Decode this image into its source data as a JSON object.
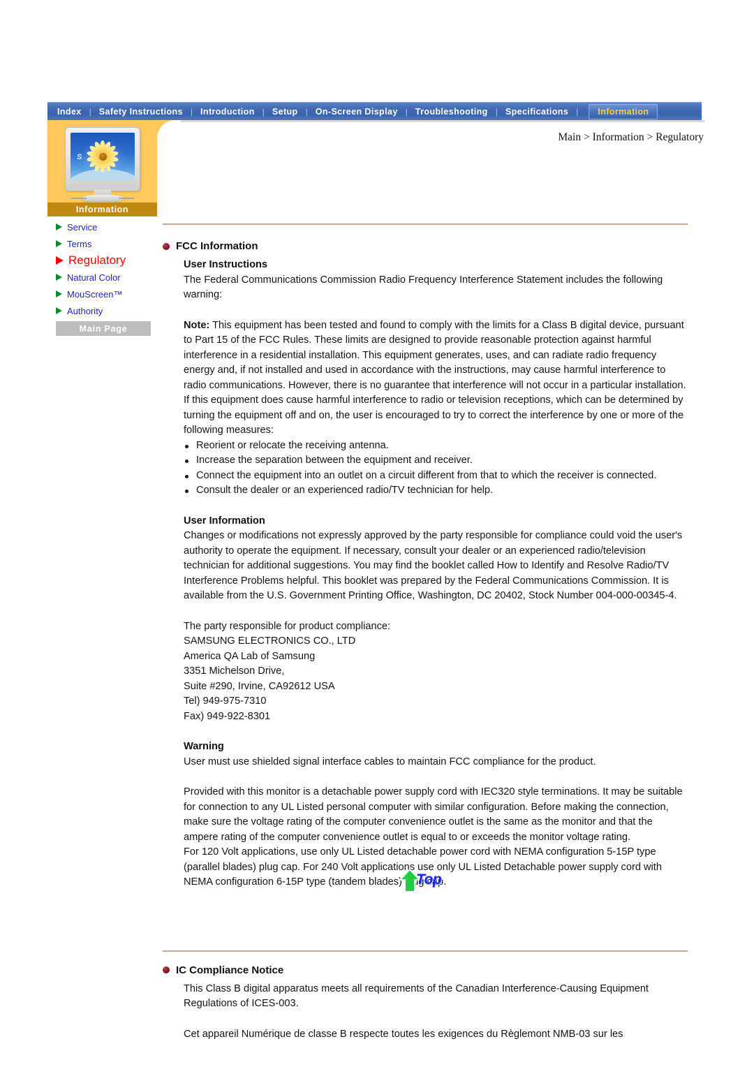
{
  "topnav": {
    "items": [
      {
        "label": "Index",
        "active": false
      },
      {
        "label": "Safety Instructions",
        "active": false
      },
      {
        "label": "Introduction",
        "active": false
      },
      {
        "label": "Setup",
        "active": false
      },
      {
        "label": "On-Screen Display",
        "active": false
      },
      {
        "label": "Troubleshooting",
        "active": false
      },
      {
        "label": "Specifications",
        "active": false
      },
      {
        "label": "Information",
        "active": true
      }
    ],
    "separator": "|"
  },
  "breadcrumb": "Main > Information > Regulatory",
  "sidebar": {
    "thumbnail_band_label": "Information",
    "monitor_logo_letter": "S",
    "items": [
      {
        "label": "Service",
        "current": false
      },
      {
        "label": "Terms",
        "current": false
      },
      {
        "label": "Regulatory",
        "current": true
      },
      {
        "label": "Natural Color",
        "current": false
      },
      {
        "label": "MouScreen™",
        "current": false
      },
      {
        "label": "Authority",
        "current": false
      }
    ],
    "main_page_button": "Main Page"
  },
  "colors": {
    "nav_blue": "#3f68b2",
    "nav_active_text": "#ffcf3d",
    "panel_orange": "#fec85c",
    "band_brown": "#c08a10",
    "link_blue": "#2222cc",
    "current_red": "#ff0000",
    "arrow_green": "#0a8a2a",
    "rule_tan": "#c3a89a",
    "section_dot": "#8c1220",
    "top_button_text": "#2222ee",
    "top_button_arrow": "#22cc44"
  },
  "sections": [
    {
      "id": "fcc",
      "title": "FCC Information",
      "blocks": [
        {
          "type": "subhead",
          "text": "User Instructions"
        },
        {
          "type": "para",
          "text": "The Federal Communications Commission Radio Frequency Interference Statement includes the following warning:"
        },
        {
          "type": "gap"
        },
        {
          "type": "para_lead",
          "lead": "Note:",
          "text": " This equipment has been tested and found to comply with the limits for a Class B digital device, pursuant to Part 15 of the FCC Rules. These limits are designed to provide reasonable protection against harmful interference in a residential installation. This equipment generates, uses, and can radiate radio frequency energy and, if not installed and used in accordance with the instructions, may cause harmful interference to radio communications. However, there is no guarantee that interference will not occur in a particular installation. If this equipment does cause harmful interference to radio or television receptions, which can be determined by turning the equipment off and on, the user is encouraged to try to correct the interference by one or more of the following measures:"
        },
        {
          "type": "list",
          "items": [
            "Reorient or relocate the receiving antenna.",
            "Increase the separation between the equipment and receiver.",
            "Connect the equipment into an outlet on a circuit different from that to which the receiver is connected.",
            "Consult the dealer or an experienced radio/TV technician for help."
          ]
        },
        {
          "type": "gap"
        },
        {
          "type": "subhead",
          "text": "User Information"
        },
        {
          "type": "para",
          "text": "Changes or modifications not expressly approved by the party responsible for compliance could void the user's authority to operate the equipment. If necessary, consult your dealer or an experienced radio/television technician for additional suggestions. You may find the booklet called How to Identify and Resolve Radio/TV Interference Problems helpful. This booklet was prepared by the Federal Communications Commission. It is available from the U.S. Government Printing Office, Washington, DC 20402, Stock Number 004-000-00345-4."
        },
        {
          "type": "gap"
        },
        {
          "type": "address",
          "lines": [
            "The party responsible for product compliance:",
            "SAMSUNG ELECTRONICS CO., LTD",
            "America QA Lab of Samsung",
            "3351 Michelson Drive,",
            "Suite #290, Irvine, CA92612 USA",
            "Tel) 949-975-7310",
            "Fax) 949-922-8301"
          ]
        },
        {
          "type": "gap"
        },
        {
          "type": "subhead",
          "text": "Warning"
        },
        {
          "type": "para",
          "text": "User must use shielded signal interface cables to maintain FCC compliance for the product."
        },
        {
          "type": "gap"
        },
        {
          "type": "para",
          "text": "Provided with this monitor is a detachable power supply cord with IEC320 style terminations. It may be suitable for connection to any UL Listed personal computer with similar configuration. Before making the connection, make sure the voltage rating of the computer convenience outlet is the same as the monitor and that the ampere rating of the computer convenience outlet is equal to or exceeds the monitor voltage rating."
        },
        {
          "type": "para",
          "text": "For 120 Volt applications, use only UL Listed detachable power cord with NEMA configuration 5-15P type (parallel blades) plug cap. For 240 Volt applications use only UL Listed Detachable power supply cord with NEMA configuration 6-15P type (tandem blades) plug cap."
        }
      ]
    },
    {
      "id": "ic",
      "title": "IC Compliance Notice",
      "blocks": [
        {
          "type": "para",
          "text": "This Class B digital apparatus meets all requirements of the Canadian Interference-Causing Equipment Regulations of ICES-003."
        },
        {
          "type": "gap"
        },
        {
          "type": "para",
          "text": "Cet appareil Numérique de classe B respecte toutes les exigences du Règlemont NMB-03 sur les"
        }
      ]
    }
  ],
  "top_button": {
    "label": "Top"
  }
}
